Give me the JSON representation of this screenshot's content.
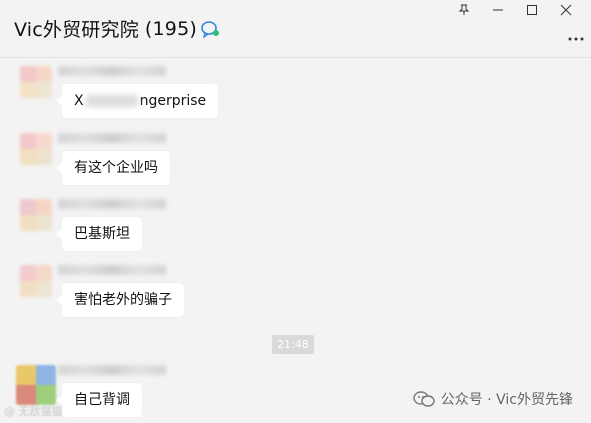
{
  "window": {
    "title": "Vic外贸研究院",
    "member_count": "(195)",
    "controls": [
      "pin-icon",
      "minimize-icon",
      "maximize-icon",
      "close-icon"
    ],
    "more_icon": "more-icon"
  },
  "messages": [
    {
      "text_prefix": "X",
      "text_suffix": "ngerprise"
    },
    {
      "text": "有这个企业吗"
    },
    {
      "text": "巴基斯坦"
    },
    {
      "text": "害怕老外的骗子"
    },
    {
      "text": "自己背调"
    }
  ],
  "timestamp": "21:48",
  "watermark": {
    "left_text": "@ 无敌猫猫",
    "text": "公众号 · Vic外贸先锋"
  },
  "colors": {
    "background": "#f3f3f3",
    "bubble": "#ffffff",
    "time_pill": "#d9d9d9"
  }
}
